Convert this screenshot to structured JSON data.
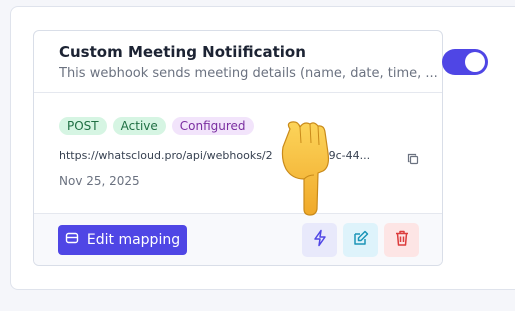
{
  "webhook": {
    "title": "Custom Meeting Notiification",
    "description": "This webhook sends meeting details (name, date, time, ...",
    "badges": {
      "method": "POST",
      "status": "Active",
      "mapping": "Configured"
    },
    "url": "https://whatscloud.pro/api/webhooks/2            009c-44...",
    "date": "Nov 25, 2025",
    "enabled": true
  },
  "actions": {
    "edit_mapping_label": "Edit mapping"
  },
  "icons": {
    "copy": "copy-icon",
    "mapping": "database-icon",
    "test": "lightning-icon",
    "edit": "pencil-icon",
    "delete": "trash-icon",
    "cursor_overlay": "pointing-hand-icon"
  },
  "colors": {
    "accent": "#4f46e5",
    "success_bg": "#d6f5e3",
    "success_text": "#1f6f43",
    "configured_bg": "#f2e4fb",
    "configured_text": "#7a2da0",
    "delete_icon": "#dc3c3c",
    "edit_icon": "#1b95b8"
  }
}
